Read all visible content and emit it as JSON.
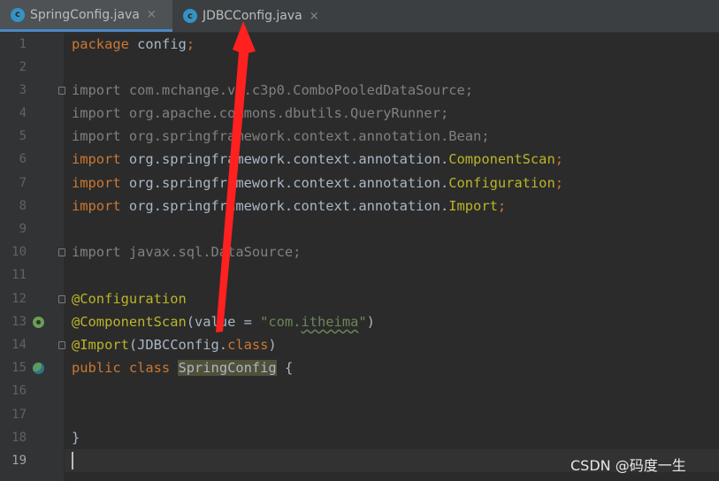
{
  "tabs": [
    {
      "label": "SpringConfig.java",
      "icon": "c-class-icon",
      "active": true
    },
    {
      "label": "JDBCConfig.java",
      "icon": "c-class-icon",
      "active": false
    }
  ],
  "tab_icon_letter": "c",
  "close_glyph": "×",
  "line_numbers": [
    "1",
    "2",
    "3",
    "4",
    "5",
    "6",
    "7",
    "8",
    "9",
    "10",
    "11",
    "12",
    "13",
    "14",
    "15",
    "16",
    "17",
    "18",
    "19"
  ],
  "code": {
    "l1_kw": "package",
    "l1_rest": " config",
    "l1_semi": ";",
    "l3": "import com.mchange.v2.c3p0.ComboPooledDataSource;",
    "l4": "import org.apache.commons.dbutils.QueryRunner;",
    "l5": "import org.springframework.context.annotation.Bean;",
    "import_kw": "import",
    "l6_path": " org.springframework.context.annotation.",
    "l6_cls": "ComponentScan",
    "l7_path": " org.springframework.context.annotation.",
    "l7_cls": "Configuration",
    "l8_path": " org.springframework.context.annotation.",
    "l8_cls": "Import",
    "semi": ";",
    "l10": "import javax.sql.DataSource;",
    "l12_ann": "@Configuration",
    "l13_ann": "@ComponentScan",
    "l13_open": "(value = ",
    "l13_str_a": "\"com.",
    "l13_str_b": "itheima",
    "l13_str_c": "\"",
    "l13_close": ")",
    "l14_ann": "@Import",
    "l14_open": "(JDBCConfig.",
    "l14_kw": "class",
    "l14_close": ")",
    "l15_kw": "public class",
    "l15_cls": "SpringConfig",
    "l15_brace": " {",
    "l18": "}"
  },
  "watermark": "CSDN @码度一生",
  "colors": {
    "background": "#2b2b2b",
    "keyword": "#cc7832",
    "annotation": "#bbb529",
    "string": "#6a8759",
    "unused_import": "#808080",
    "arrow": "#ff2020"
  }
}
